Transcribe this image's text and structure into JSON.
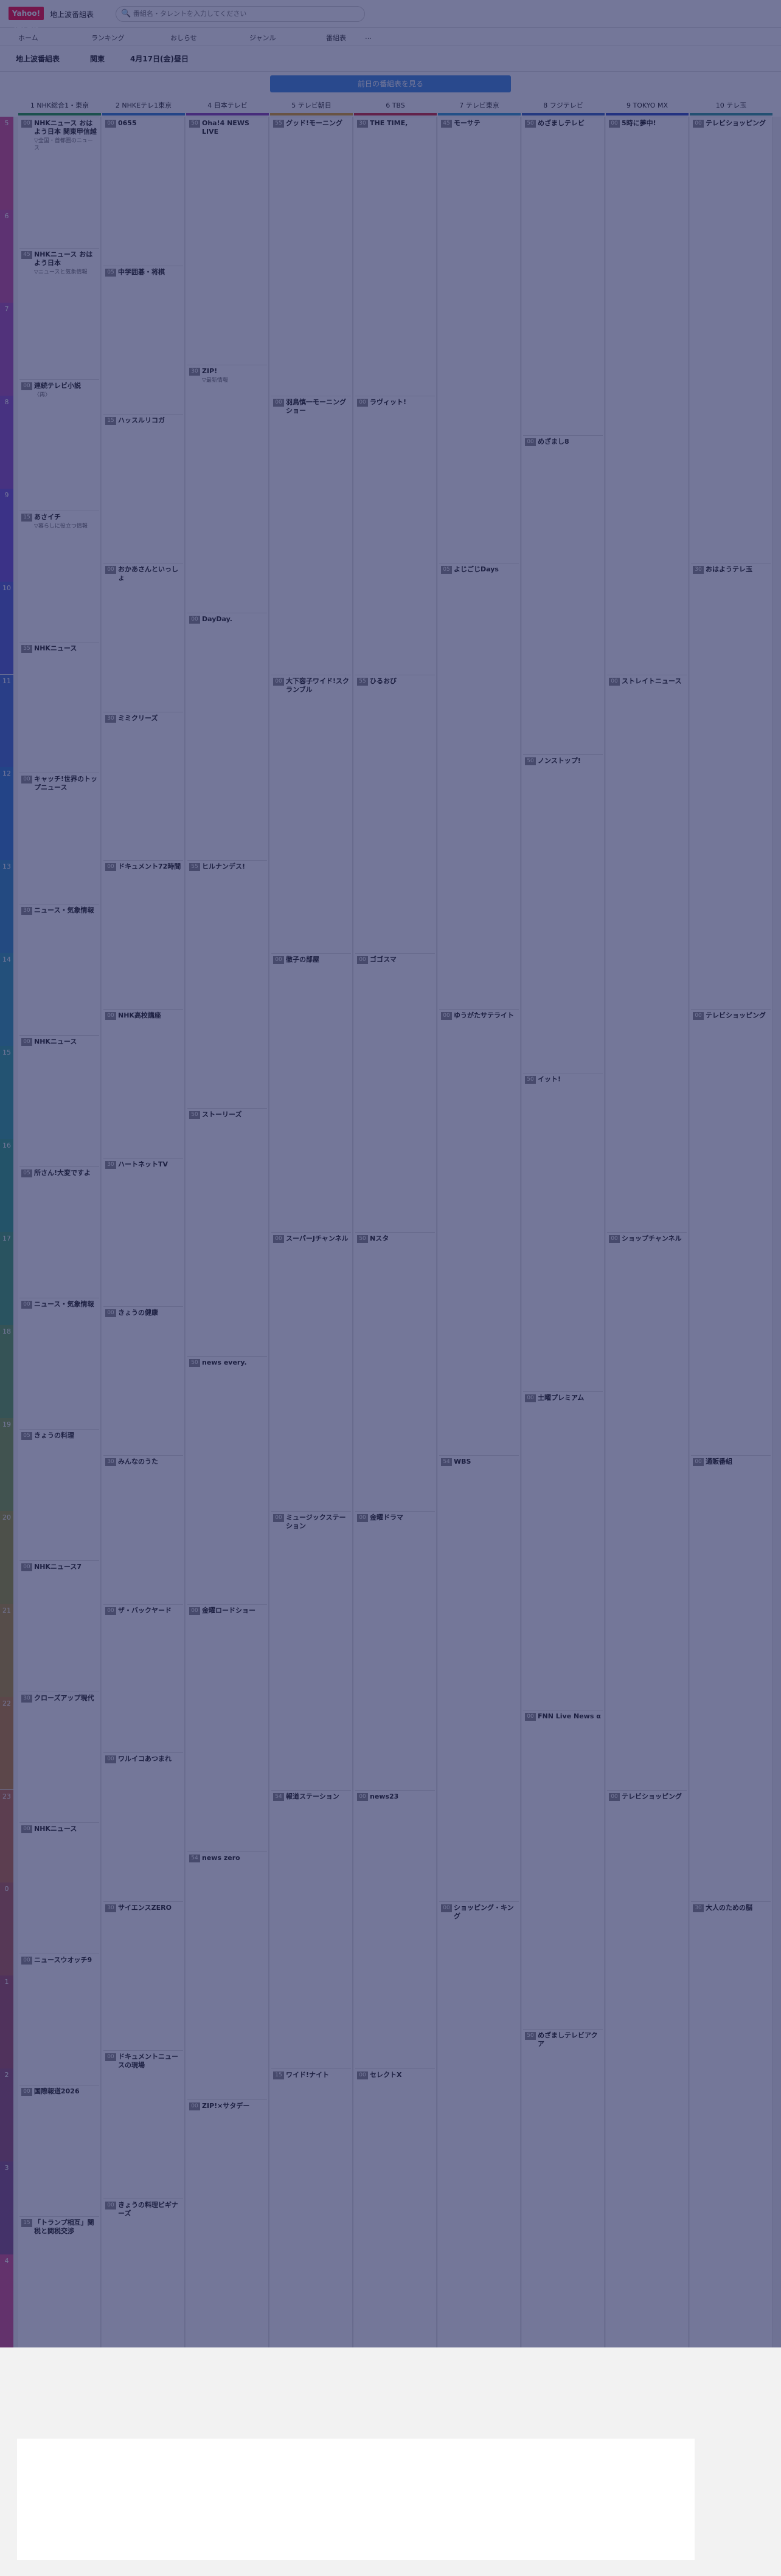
{
  "header": {
    "logo": "Yahoo! JAPAN",
    "site_name": "地上波番組表",
    "search_placeholder": "番組名・タレントを入力してください",
    "search_icon": "search-icon"
  },
  "nav": [
    "ホーム",
    "ランキング",
    "おしらせ",
    "ジャンル",
    "番組表",
    "…"
  ],
  "filters": {
    "area": "地上波番組表",
    "region": "関東",
    "date": "4月17日(金)昼日"
  },
  "prev_button": "前日の番組表を見る",
  "stations": [
    {
      "label": "1 NHK総合1・東京",
      "color": "#1a9a3a"
    },
    {
      "label": "2 NHKEテレ1東京",
      "color": "#2a7ad0"
    },
    {
      "label": "4 日本テレビ",
      "color": "#8a3ab0"
    },
    {
      "label": "5 テレビ朝日",
      "color": "#e0a020"
    },
    {
      "label": "6 TBS",
      "color": "#d02030"
    },
    {
      "label": "7 テレビ東京",
      "color": "#2a9ad0"
    },
    {
      "label": "8 フジテレビ",
      "color": "#3060c0"
    },
    {
      "label": "9 TOKYO MX",
      "color": "#2a4ac0"
    },
    {
      "label": "10 テレ玉",
      "color": "#2a9a9a"
    }
  ],
  "hours": [
    "5",
    "6",
    "7",
    "8",
    "9",
    "10",
    "11",
    "12",
    "13",
    "14",
    "15",
    "16",
    "17",
    "18",
    "19",
    "20",
    "21",
    "22",
    "23",
    "0",
    "1",
    "2",
    "3",
    "4"
  ],
  "columns": [
    [
      {
        "min": "00",
        "title": "NHKニュース おはよう日本 関東甲信越",
        "desc": "▽全国・首都圏のニュース"
      },
      {
        "min": "45",
        "title": "NHKニュース おはよう日本",
        "desc": "▽ニュースと気象情報"
      },
      {
        "min": "00",
        "title": "連続テレビ小説",
        "desc": "〈再〉"
      },
      {
        "min": "15",
        "title": "あさイチ",
        "desc": "▽暮らしに役立つ情報"
      },
      {
        "min": "55",
        "title": "NHKニュース",
        "desc": ""
      },
      {
        "min": "00",
        "title": "キャッチ!世界のトップニュース",
        "desc": ""
      },
      {
        "min": "30",
        "title": "ニュース・気象情報",
        "desc": ""
      },
      {
        "min": "00",
        "title": "NHKニュース",
        "desc": ""
      },
      {
        "min": "05",
        "title": "所さん!大変ですよ",
        "desc": ""
      },
      {
        "min": "00",
        "title": "ニュース・気象情報",
        "desc": ""
      },
      {
        "min": "05",
        "title": "きょうの料理",
        "desc": ""
      },
      {
        "min": "00",
        "title": "NHKニュース7",
        "desc": ""
      },
      {
        "min": "30",
        "title": "クローズアップ現代",
        "desc": ""
      },
      {
        "min": "00",
        "title": "NHKニュース",
        "desc": ""
      },
      {
        "min": "00",
        "title": "ニュースウオッチ9",
        "desc": ""
      },
      {
        "min": "00",
        "title": "国際報道2026",
        "desc": ""
      },
      {
        "min": "15",
        "title": "「トランプ相互」関税と関税交渉",
        "desc": ""
      }
    ],
    [
      {
        "min": "00",
        "title": "0655",
        "desc": ""
      },
      {
        "min": "05",
        "title": "中学囲碁・将棋",
        "desc": ""
      },
      {
        "min": "15",
        "title": "ハッスルリコガ",
        "desc": ""
      },
      {
        "min": "00",
        "title": "おかあさんといっしょ",
        "desc": ""
      },
      {
        "min": "30",
        "title": "ミミクリーズ",
        "desc": ""
      },
      {
        "min": "00",
        "title": "ドキュメント72時間",
        "desc": ""
      },
      {
        "min": "00",
        "title": "NHK高校講座",
        "desc": ""
      },
      {
        "min": "30",
        "title": "ハートネットTV",
        "desc": ""
      },
      {
        "min": "00",
        "title": "きょうの健康",
        "desc": ""
      },
      {
        "min": "30",
        "title": "みんなのうた",
        "desc": ""
      },
      {
        "min": "00",
        "title": "ザ・バックヤード",
        "desc": ""
      },
      {
        "min": "00",
        "title": "ワルイコあつまれ",
        "desc": ""
      },
      {
        "min": "30",
        "title": "サイエンスZERO",
        "desc": ""
      },
      {
        "min": "00",
        "title": "ドキュメントニュースの現場",
        "desc": ""
      },
      {
        "min": "00",
        "title": "きょうの料理ビギナーズ",
        "desc": ""
      }
    ],
    [
      {
        "min": "50",
        "title": "Oha!4 NEWS LIVE",
        "desc": ""
      },
      {
        "min": "30",
        "title": "ZIP!",
        "desc": "▽最新情報"
      },
      {
        "min": "00",
        "title": "DayDay.",
        "desc": ""
      },
      {
        "min": "55",
        "title": "ヒルナンデス!",
        "desc": ""
      },
      {
        "min": "50",
        "title": "ストーリーズ",
        "desc": ""
      },
      {
        "min": "50",
        "title": "news every.",
        "desc": ""
      },
      {
        "min": "00",
        "title": "金曜ロードショー",
        "desc": ""
      },
      {
        "min": "54",
        "title": "news zero",
        "desc": ""
      },
      {
        "min": "00",
        "title": "ZIP!×サタデー",
        "desc": ""
      }
    ],
    [
      {
        "min": "55",
        "title": "グッド!モーニング",
        "desc": ""
      },
      {
        "min": "00",
        "title": "羽鳥慎一モーニングショー",
        "desc": ""
      },
      {
        "min": "00",
        "title": "大下容子ワイド!スクランブル",
        "desc": ""
      },
      {
        "min": "00",
        "title": "徹子の部屋",
        "desc": ""
      },
      {
        "min": "00",
        "title": "スーパーJチャンネル",
        "desc": ""
      },
      {
        "min": "00",
        "title": "ミュージックステーション",
        "desc": ""
      },
      {
        "min": "54",
        "title": "報道ステーション",
        "desc": ""
      },
      {
        "min": "15",
        "title": "ワイド!ナイト",
        "desc": ""
      }
    ],
    [
      {
        "min": "30",
        "title": "THE TIME,",
        "desc": ""
      },
      {
        "min": "00",
        "title": "ラヴィット!",
        "desc": ""
      },
      {
        "min": "55",
        "title": "ひるおび",
        "desc": ""
      },
      {
        "min": "00",
        "title": "ゴゴスマ",
        "desc": ""
      },
      {
        "min": "50",
        "title": "Nスタ",
        "desc": ""
      },
      {
        "min": "00",
        "title": "金曜ドラマ",
        "desc": ""
      },
      {
        "min": "00",
        "title": "news23",
        "desc": ""
      },
      {
        "min": "00",
        "title": "セレクトX",
        "desc": ""
      }
    ],
    [
      {
        "min": "45",
        "title": "モーサテ",
        "desc": ""
      },
      {
        "min": "05",
        "title": "よじごじDays",
        "desc": ""
      },
      {
        "min": "00",
        "title": "ゆうがたサテライト",
        "desc": ""
      },
      {
        "min": "54",
        "title": "WBS",
        "desc": ""
      },
      {
        "min": "00",
        "title": "ショッピング・キング",
        "desc": ""
      }
    ],
    [
      {
        "min": "50",
        "title": "めざましテレビ",
        "desc": ""
      },
      {
        "min": "00",
        "title": "めざまし8",
        "desc": ""
      },
      {
        "min": "50",
        "title": "ノンストップ!",
        "desc": ""
      },
      {
        "min": "50",
        "title": "イット!",
        "desc": ""
      },
      {
        "min": "00",
        "title": "土曜プレミアム",
        "desc": ""
      },
      {
        "min": "00",
        "title": "FNN Live News α",
        "desc": ""
      },
      {
        "min": "50",
        "title": "めざましテレビアクア",
        "desc": ""
      }
    ],
    [
      {
        "min": "00",
        "title": "5時に夢中!",
        "desc": ""
      },
      {
        "min": "00",
        "title": "ストレイトニュース",
        "desc": ""
      },
      {
        "min": "00",
        "title": "ショップチャンネル",
        "desc": ""
      },
      {
        "min": "00",
        "title": "テレビショッピング",
        "desc": ""
      }
    ],
    [
      {
        "min": "00",
        "title": "テレビショッピング",
        "desc": ""
      },
      {
        "min": "30",
        "title": "おはようテレ玉",
        "desc": ""
      },
      {
        "min": "00",
        "title": "テレビショッピング",
        "desc": ""
      },
      {
        "min": "00",
        "title": "通販番組",
        "desc": ""
      },
      {
        "min": "30",
        "title": "大人のための脳",
        "desc": ""
      }
    ]
  ]
}
